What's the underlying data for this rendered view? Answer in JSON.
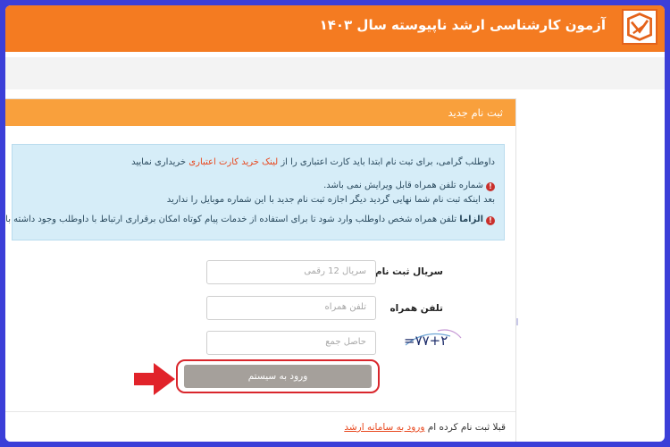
{
  "header": {
    "title": "آزمون کارشناسی ارشد ناپیوسته سال ۱۴۰۳",
    "logo_icon": "brand-logo-icon",
    "bg_color": "#f47b21"
  },
  "card": {
    "title": "ثبت نام جدید",
    "header_color": "#f9a03c"
  },
  "alert": {
    "line1_before": "داوطلب گرامی، برای ثبت نام ابتدا باید کارت اعتباری را از ",
    "line1_link": "لینک خرید کارت اعتباری",
    "line1_after": " خریداری نمایید",
    "line2": "شماره تلفن همراه قابل ویرایش نمی باشد.",
    "line3": "بعد اینکه ثبت نام شما نهایی گردید دیگر اجازه ثبت نام جدید با این شماره موبایل را ندارید",
    "line4_bold": "الزاما",
    "line4_rest": " تلفن همراه شخص داوطلب وارد شود تا برای استفاده از خدمات پیام کوتاه امکان برقراری ارتباط با داوطلب وجود داشته باشد",
    "warn_icon": "exclamation-circle-icon"
  },
  "form": {
    "serial_label": "سریال ثبت نام",
    "serial_placeholder": "سریال 12 رقمی",
    "phone_label": "تلفن همراه",
    "phone_placeholder": "تلفن همراه",
    "result_placeholder": "حاصل جمع",
    "captcha_text": "=۷۷+۲"
  },
  "submit": {
    "label": "ورود به سیستم",
    "color": "#a5a09b"
  },
  "annotation": {
    "arrow_color": "#e1232a",
    "outline_color": "#d9262c"
  },
  "footer": {
    "prefix": "قبلا ثبت نام کرده ام ",
    "link": "ورود به سامانه ارشد"
  }
}
